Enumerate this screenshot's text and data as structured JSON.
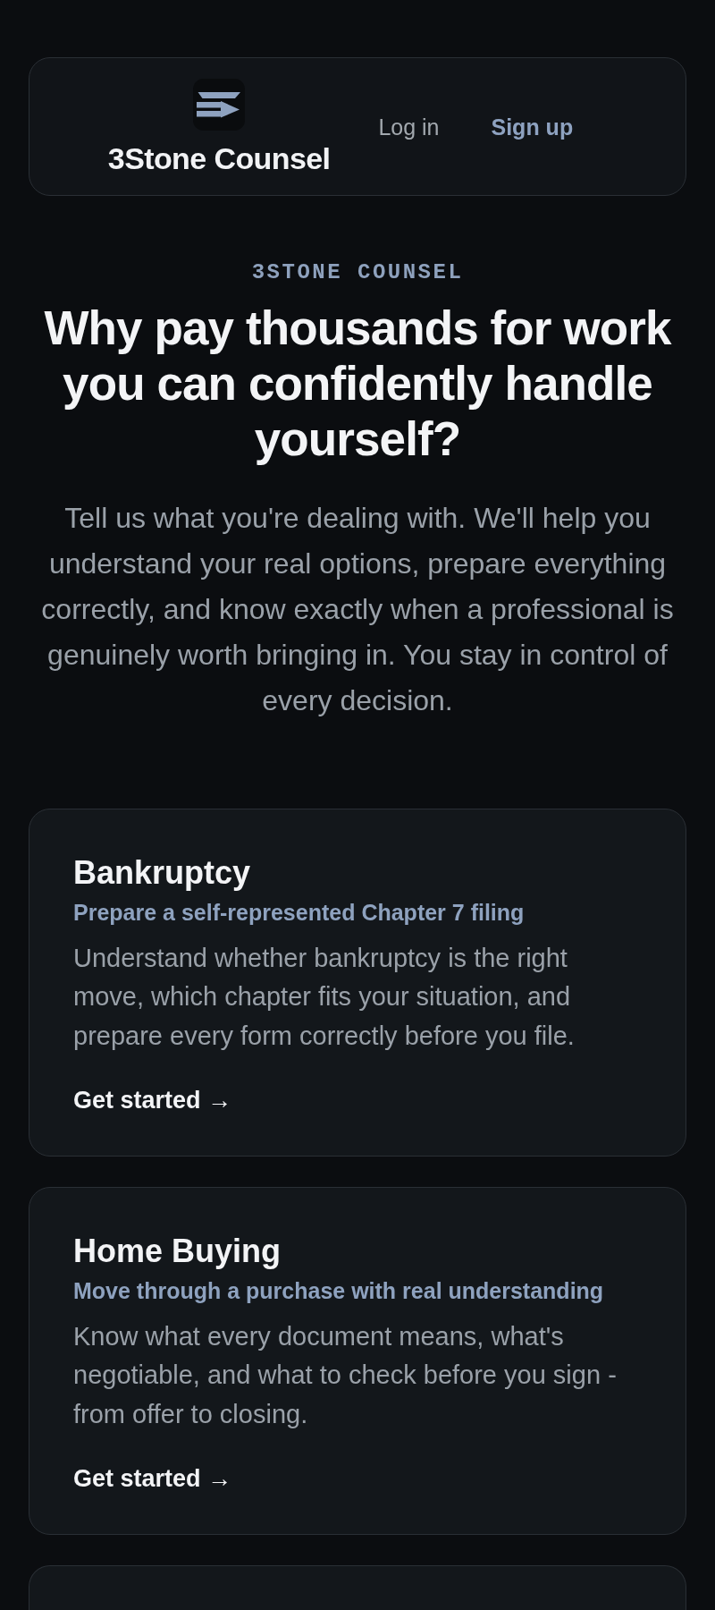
{
  "header": {
    "brand": "3Stone Counsel",
    "nav": [
      {
        "label": "Log in",
        "kind": "plain"
      },
      {
        "label": "Sign up",
        "kind": "accent"
      }
    ]
  },
  "hero": {
    "eyebrow": "3STONE COUNSEL",
    "title": "Why pay thousands for work you can confidently handle yourself?",
    "description": "Tell us what you're dealing with. We'll help you understand your real options, prepare everything correctly, and know exactly when a professional is genuinely worth bringing in. You stay in control of every decision."
  },
  "cards": [
    {
      "title": "Bankruptcy",
      "subtitle": "Prepare a self-represented Chapter 7 filing",
      "description": "Understand whether bankruptcy is the right move, which chapter fits your situation, and prepare every form correctly before you file.",
      "link": "Get started →"
    },
    {
      "title": "Home Buying",
      "subtitle": "Move through a purchase with real understanding",
      "description": "Know what every document means, what's negotiable, and what to check before you sign - from offer to closing.",
      "link": "Get started →"
    }
  ]
}
